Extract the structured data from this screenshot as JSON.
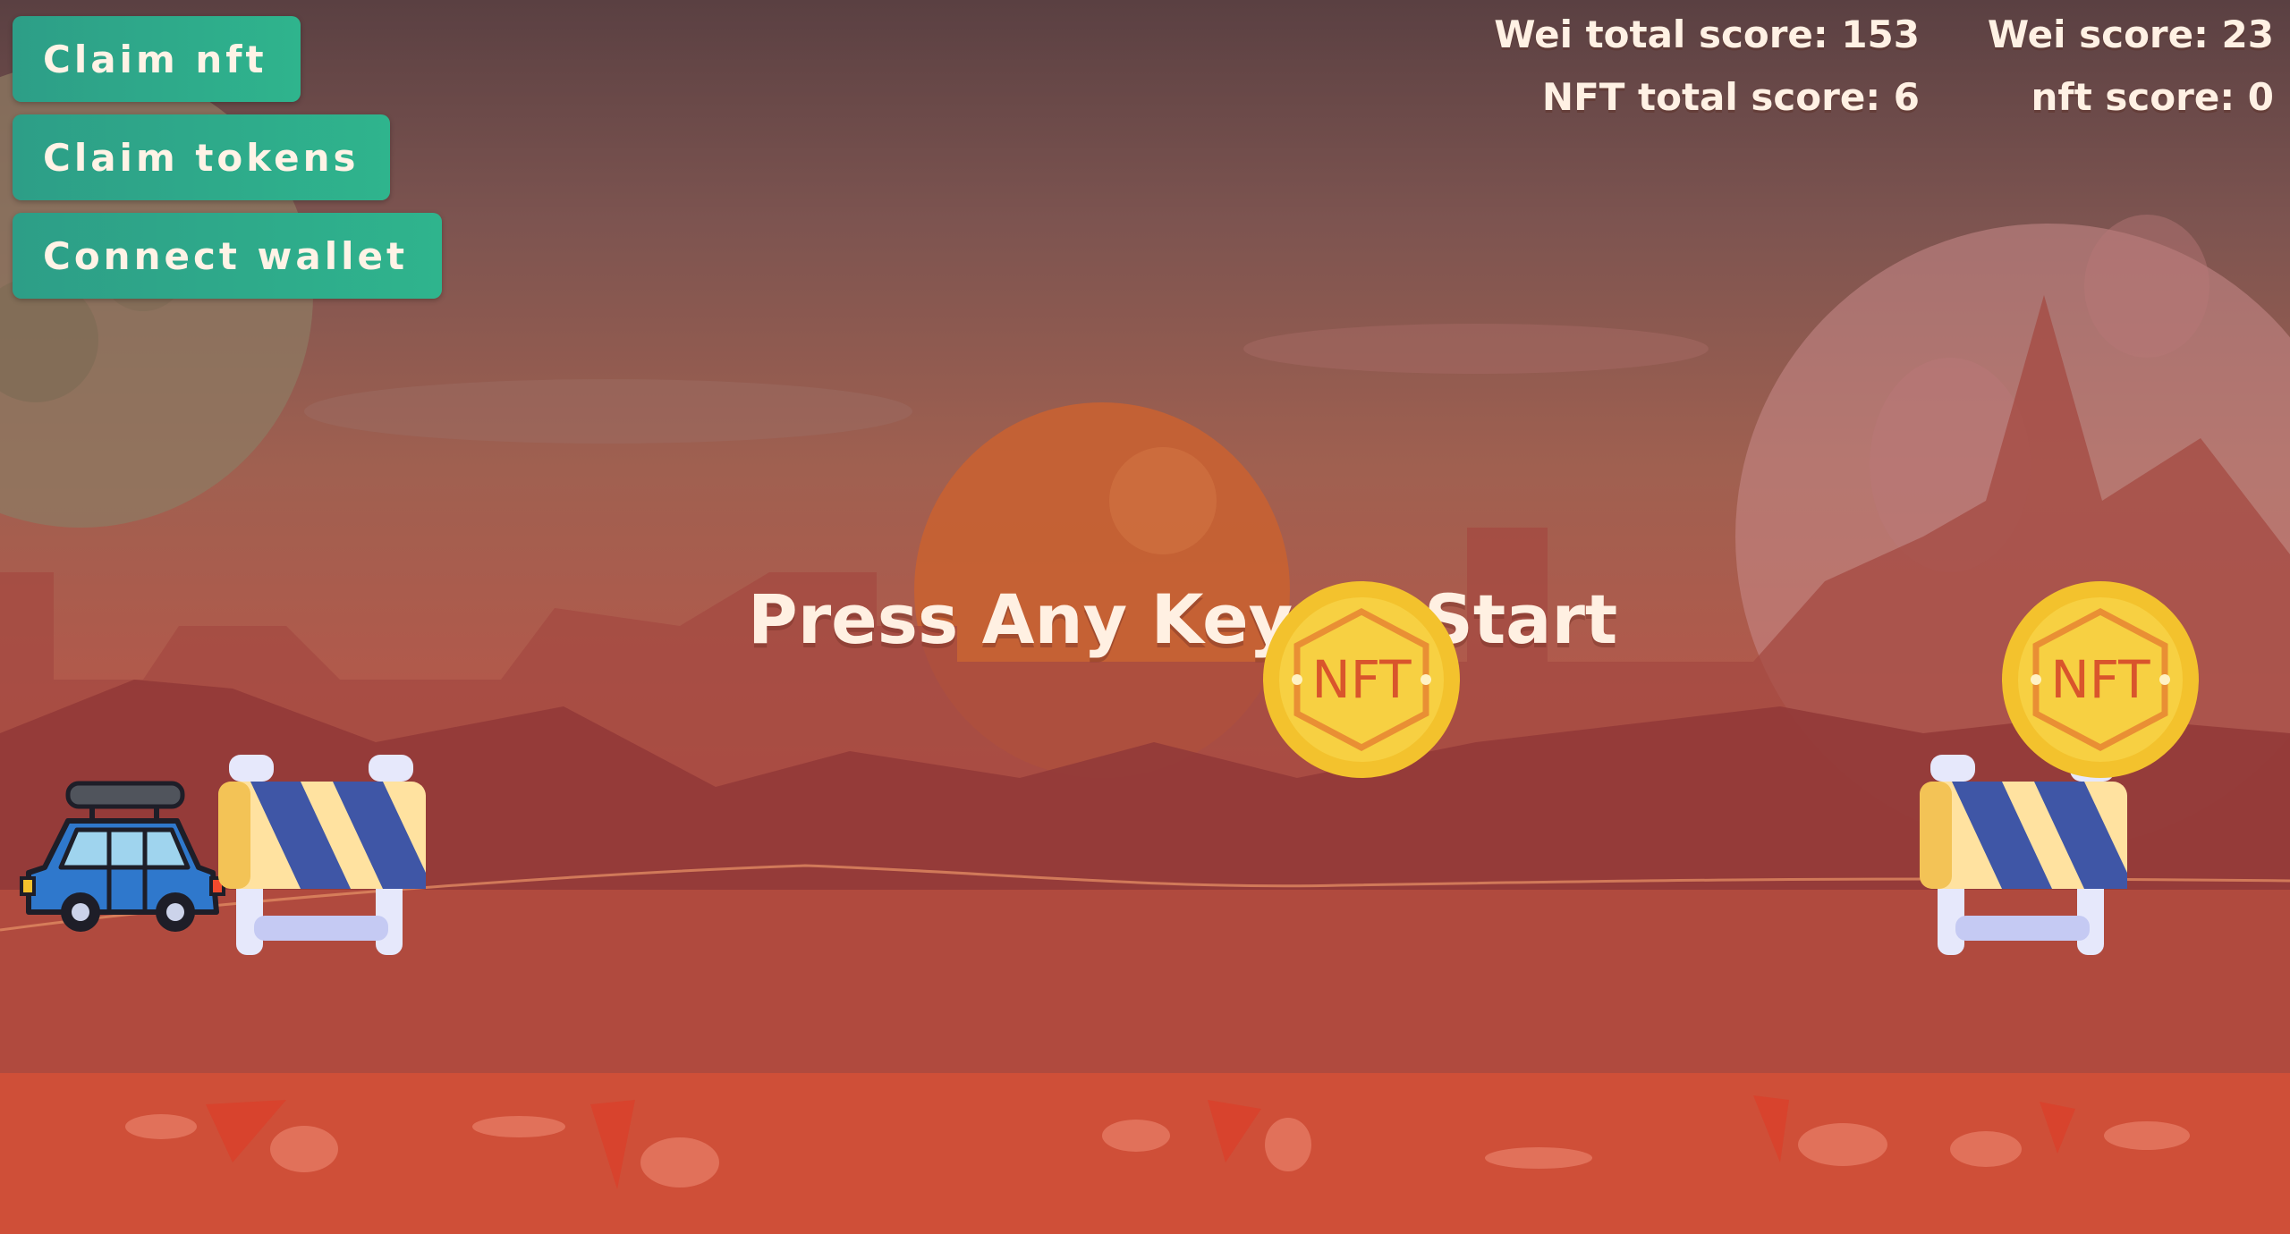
{
  "buttons": {
    "claim_nft": "Claim nft",
    "claim_tokens": "Claim tokens",
    "connect_wallet": "Connect wallet"
  },
  "scores": {
    "wei_total_label": "Wei total score: 153",
    "wei_label": "Wei score: 23",
    "nft_total_label": "NFT total score: 6",
    "nft_label": "nft score: 0"
  },
  "prompt": "Press Any Key To Start",
  "coins": [
    {
      "label": "NFT"
    },
    {
      "label": "NFT"
    }
  ],
  "colors": {
    "button": "#2fa98a",
    "text": "#fff1e4",
    "coin": "#f3c22d",
    "coin_text": "#d9552c",
    "car": "#2f78cc"
  }
}
